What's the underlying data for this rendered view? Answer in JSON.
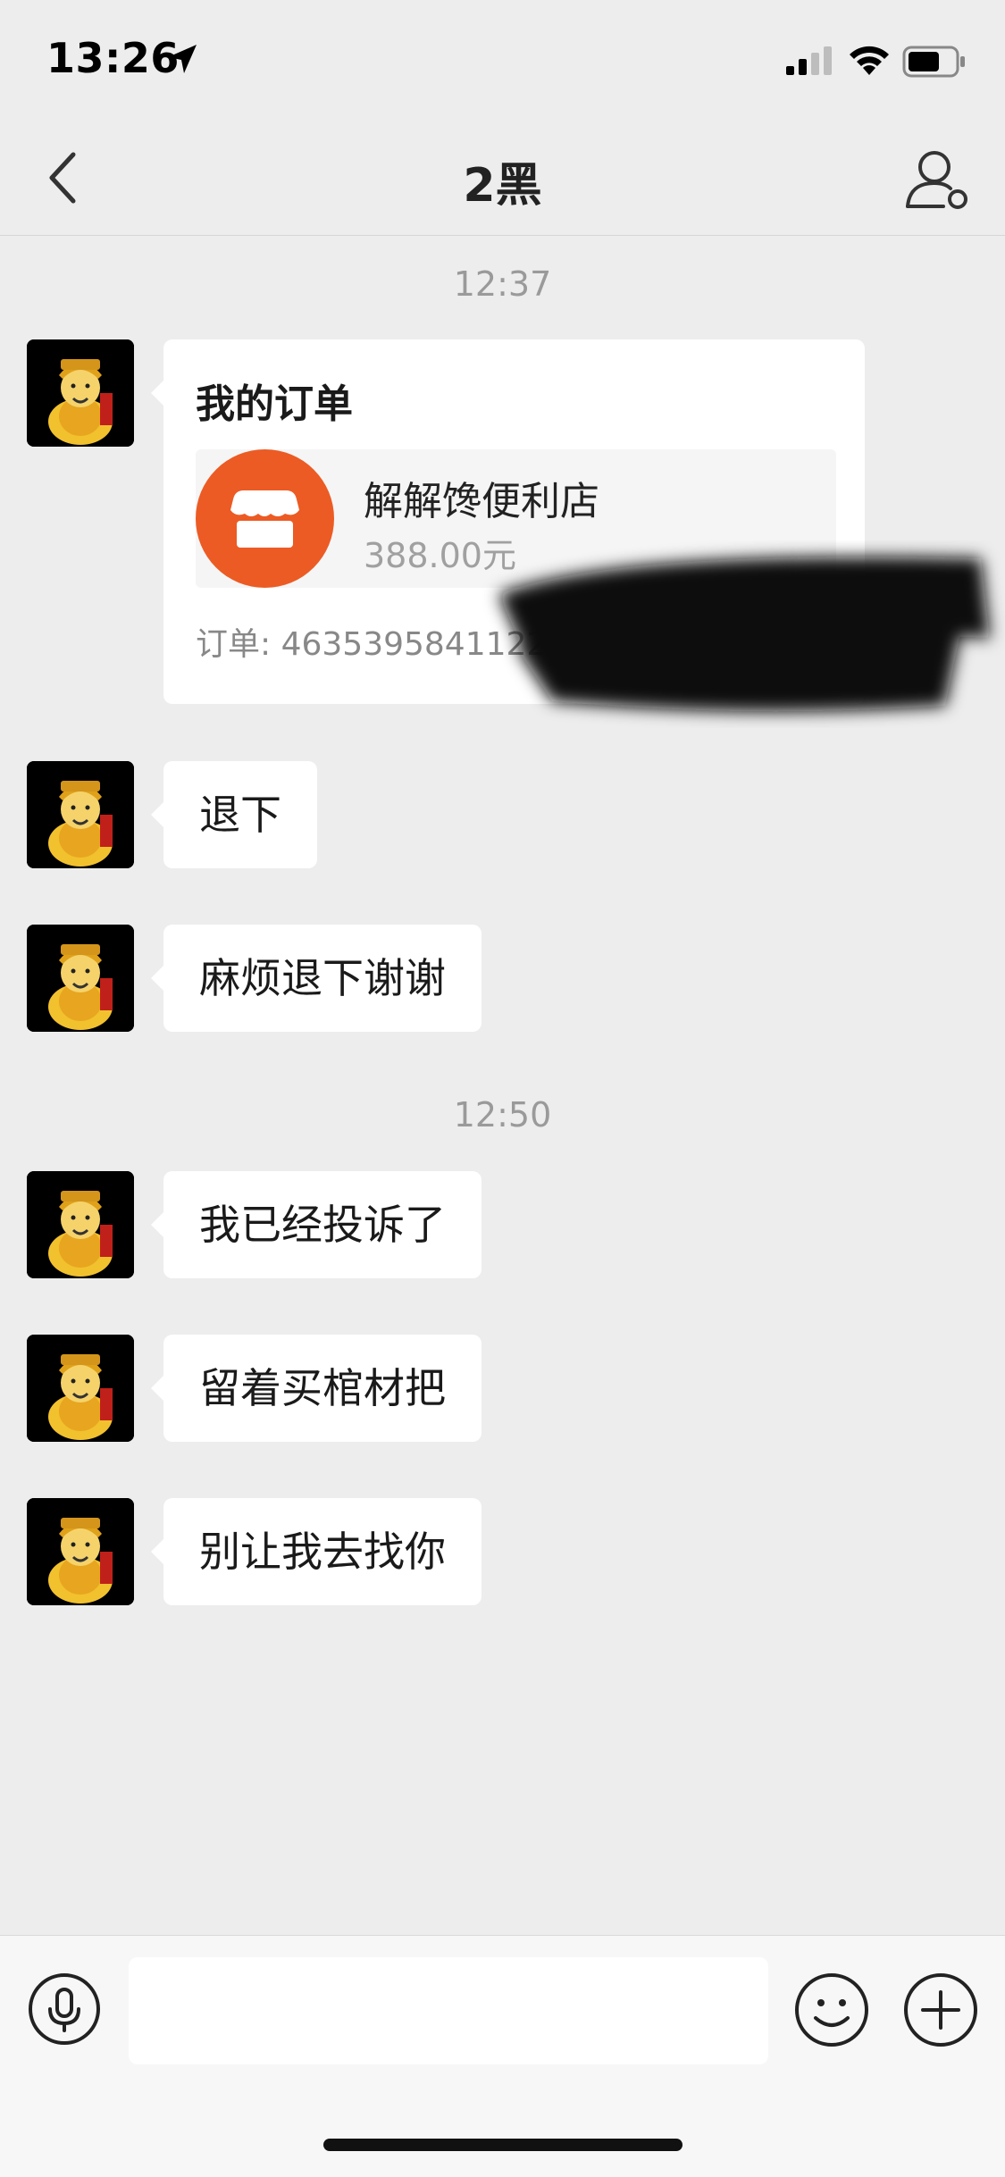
{
  "status_bar": {
    "time": "13:26"
  },
  "header": {
    "title": "2黑"
  },
  "messages": {
    "time1": "12:37",
    "order": {
      "title": "我的订单",
      "store_name": "解解馋便利店",
      "price": "388.00元",
      "order_number": "订单: 4635395841122524687867"
    },
    "msg1": "退下",
    "msg2": "麻烦退下谢谢",
    "time2": "12:50",
    "msg3": "我已经投诉了",
    "msg4": "留着买棺材把",
    "msg5": "别让我去找你"
  },
  "input": {
    "placeholder": ""
  },
  "colors": {
    "background": "#EDEDED",
    "store_accent": "#EC5B24",
    "bubble": "#FFFFFF"
  }
}
